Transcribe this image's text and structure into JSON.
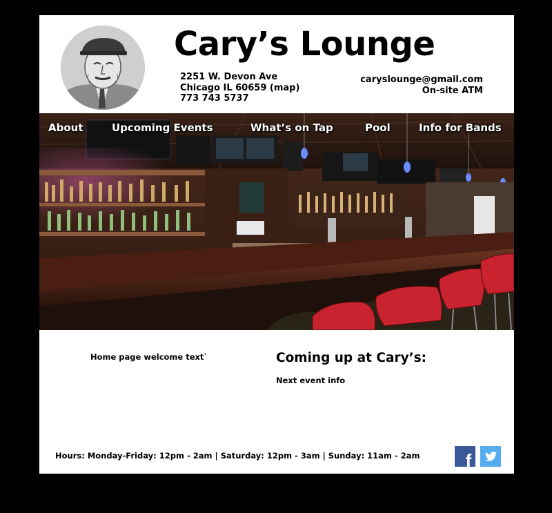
{
  "header": {
    "title": "Cary’s Lounge",
    "address_line1": "2251 W. Devon Ave",
    "address_line2_prefix": "Chicago IL 60659 ",
    "map_link": "(map)",
    "phone": "773 743 5737",
    "email": "caryslounge@gmail.com",
    "atm": "On-site ATM"
  },
  "nav": {
    "items": [
      {
        "label": "About"
      },
      {
        "label": "Upcoming Events"
      },
      {
        "label": "What’s on Tap"
      },
      {
        "label": "Pool"
      },
      {
        "label": "Info for Bands"
      }
    ]
  },
  "main": {
    "welcome_text": "Home page welcome text`",
    "coming_up_title": "Coming up at Cary’s:",
    "next_event": "Next event info"
  },
  "footer": {
    "hours": "Hours: Monday-Friday: 12pm - 2am | Saturday: 12pm - 3am | Sunday: 11am - 2am",
    "facebook_icon_letter": "f"
  },
  "colors": {
    "page_bg": "#000000",
    "content_bg": "#ffffff",
    "facebook": "#3b5998",
    "twitter": "#55acee"
  }
}
